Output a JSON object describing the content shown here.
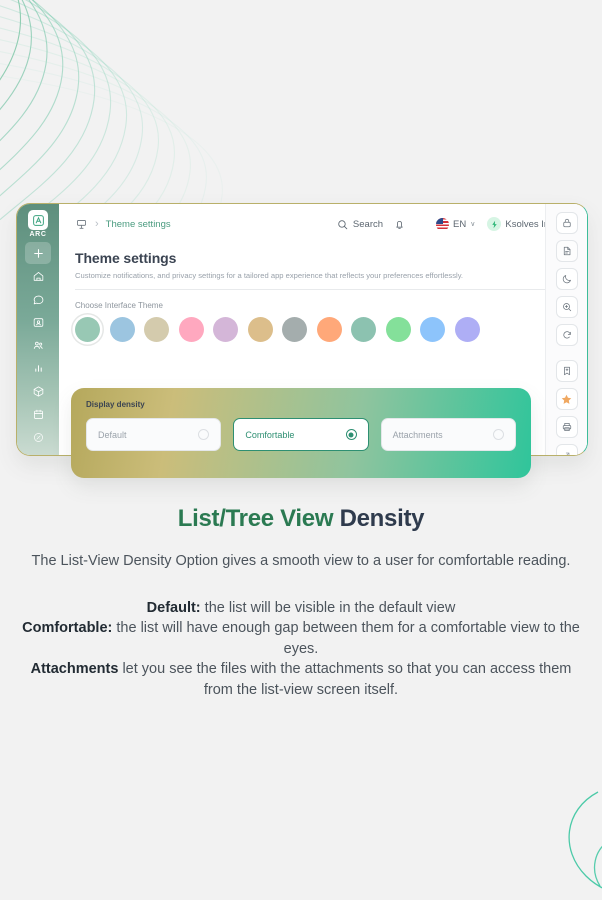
{
  "app": {
    "logo_text": "ARC",
    "breadcrumb": {
      "home_icon": "panel-icon",
      "separator": "›",
      "current": "Theme settings"
    },
    "topbar": {
      "search_label": "Search",
      "search_icon": "search-icon",
      "bell_icon": "bell-icon",
      "chat_icon": "chat-icon",
      "language": "EN",
      "language_flag": "us-flag-icon",
      "organization": "Ksolves India",
      "organization_badge": "lightning-icon",
      "chevron": "∨"
    },
    "page": {
      "title": "Theme settings",
      "subtitle": "Customize notifications, and privacy settings for a tailored app experience that reflects your preferences effortlessly."
    },
    "theme_section": {
      "label": "Choose Interface Theme",
      "selected_index": 0,
      "swatches": [
        {
          "name": "theme-swatch-teal-sage",
          "color": "#98c8b4"
        },
        {
          "name": "theme-swatch-sky-blue",
          "color": "#9cc5e0"
        },
        {
          "name": "theme-swatch-sand",
          "color": "#d4cbad"
        },
        {
          "name": "theme-swatch-pink",
          "color": "#ffa8bf"
        },
        {
          "name": "theme-swatch-lilac",
          "color": "#d4b6d8"
        },
        {
          "name": "theme-swatch-tan",
          "color": "#dcbe8b"
        },
        {
          "name": "theme-swatch-gray",
          "color": "#a4adad"
        },
        {
          "name": "theme-swatch-peach",
          "color": "#ffa879"
        },
        {
          "name": "theme-swatch-teal",
          "color": "#8cc2b0"
        },
        {
          "name": "theme-swatch-green",
          "color": "#84e09a"
        },
        {
          "name": "theme-swatch-blue",
          "color": "#8dc4fb"
        },
        {
          "name": "theme-swatch-periwinkle",
          "color": "#aeaef5"
        }
      ]
    },
    "sidebar_items": [
      {
        "name": "sidebar-item-add",
        "icon": "plus-icon",
        "active": true
      },
      {
        "name": "sidebar-item-home",
        "icon": "home-icon",
        "active": false
      },
      {
        "name": "sidebar-item-messages",
        "icon": "chat-icon",
        "active": false
      },
      {
        "name": "sidebar-item-contacts",
        "icon": "contact-card-icon",
        "active": false
      },
      {
        "name": "sidebar-item-users",
        "icon": "users-icon",
        "active": false
      },
      {
        "name": "sidebar-item-reports",
        "icon": "bar-chart-icon",
        "active": false
      },
      {
        "name": "sidebar-item-products",
        "icon": "box-icon",
        "active": false
      },
      {
        "name": "sidebar-item-calendar",
        "icon": "calendar-icon",
        "active": false
      },
      {
        "name": "sidebar-item-settings",
        "icon": "gear-icon",
        "active": false
      }
    ],
    "rail_items": [
      {
        "name": "rail-button-lock",
        "icon": "lock-icon"
      },
      {
        "name": "rail-button-document",
        "icon": "document-icon"
      },
      {
        "name": "rail-button-dark-mode",
        "icon": "moon-icon"
      },
      {
        "name": "rail-button-zoom-in",
        "icon": "zoom-in-icon"
      },
      {
        "name": "rail-button-refresh",
        "icon": "refresh-icon"
      },
      {
        "name": "rail-button-bookmark",
        "icon": "bookmark-add-icon"
      },
      {
        "name": "rail-button-favorite",
        "icon": "star-icon"
      },
      {
        "name": "rail-button-print",
        "icon": "printer-icon"
      },
      {
        "name": "rail-button-expand",
        "icon": "expand-arrow-icon"
      }
    ],
    "density": {
      "title": "Display density",
      "options": [
        {
          "label": "Default",
          "selected": false
        },
        {
          "label": "Comfortable",
          "selected": true
        },
        {
          "label": "Attachments",
          "selected": false
        }
      ]
    }
  },
  "caption": {
    "heading_green": "List/Tree View ",
    "heading_dark": "Density",
    "lead": "The List-View Density Option gives a smooth view to a user for comfortable reading.",
    "items": [
      {
        "term": "Default:",
        "text": " the list will be visible in the default view"
      },
      {
        "term": "Comfortable:",
        "text": " the list will have enough gap between them for a comfortable view to the eyes."
      },
      {
        "term": "Attachments",
        "text": " let you see the files with the attachments so that you can access them from the list-view screen itself."
      }
    ]
  },
  "colors": {
    "brand_green": "#2e8f72",
    "heading_green": "#2b7a52",
    "heading_dark": "#2f3b4d",
    "star_orange": "#f0a861"
  }
}
